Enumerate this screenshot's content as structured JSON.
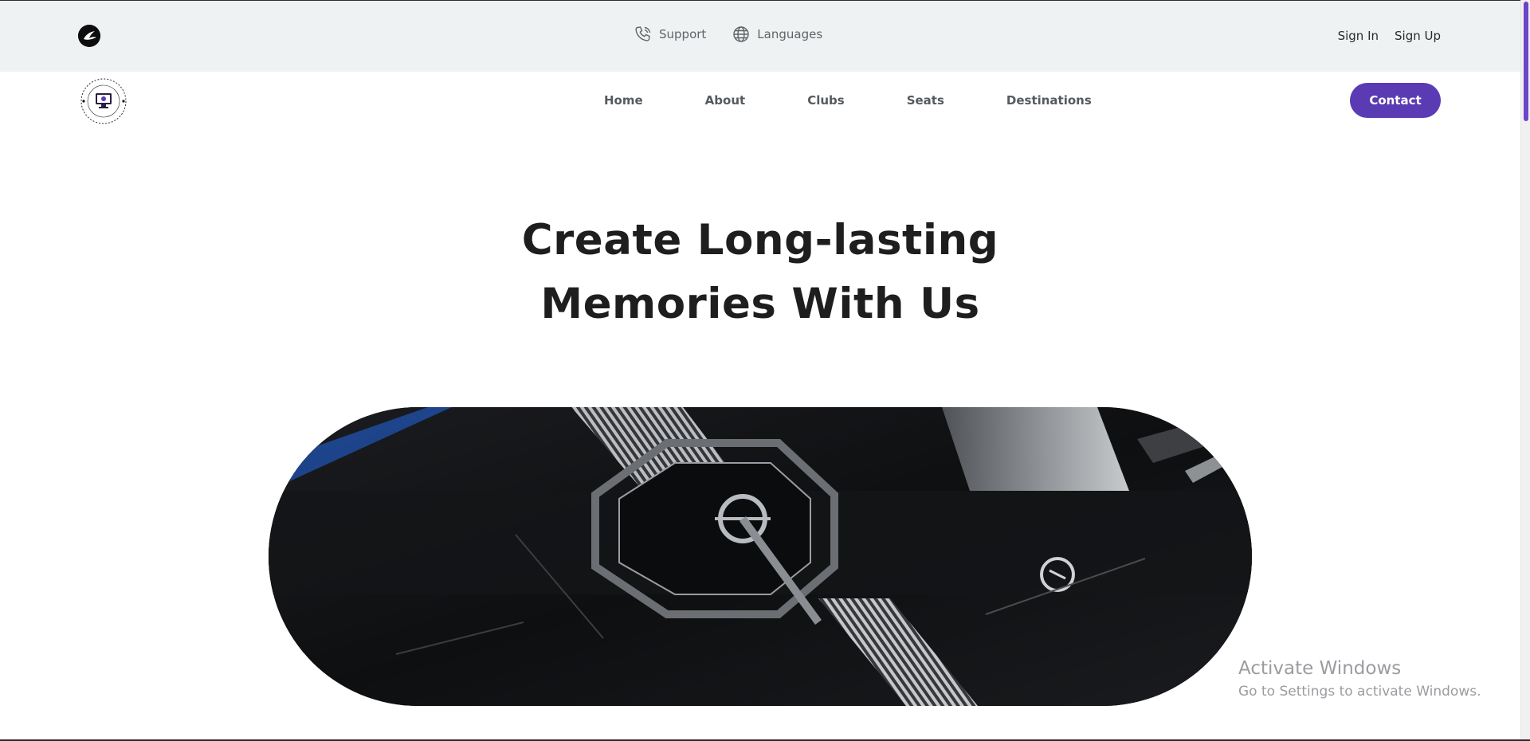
{
  "colors": {
    "accent": "#5b3bb4",
    "topbar_bg": "#eff2f3",
    "text_dark": "#1e1e1e",
    "scroll_thumb": "#6a45c8"
  },
  "topbar": {
    "brand_icon": "airline-bird-logo-icon",
    "support": {
      "icon": "phone-icon",
      "label": "Support"
    },
    "languages": {
      "icon": "globe-icon",
      "label": "Languages"
    },
    "sign_in": "Sign In",
    "sign_up": "Sign Up"
  },
  "nav": {
    "logo_icon": "monitor-seal-logo",
    "links": [
      "Home",
      "About",
      "Clubs",
      "Seats",
      "Destinations"
    ],
    "contact": "Contact"
  },
  "hero": {
    "title_line1": "Create Long-lasting",
    "title_line2": "Memories With Us",
    "media": "dark-mechanical-video-frame"
  },
  "watermark": {
    "title": "Activate Windows",
    "subtitle": "Go to Settings to activate Windows."
  }
}
